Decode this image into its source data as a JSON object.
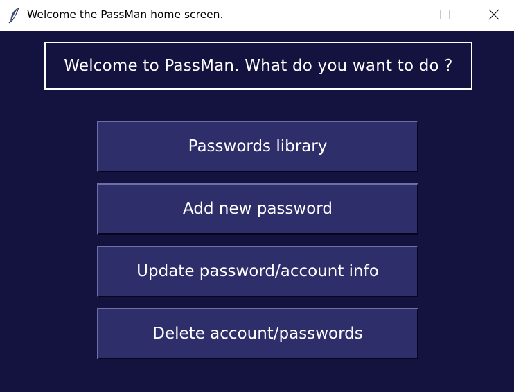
{
  "window": {
    "title": "Welcome the PassMan home screen.",
    "app_icon": "feather-icon",
    "controls": {
      "minimize_icon": "minimize-icon",
      "maximize_icon": "maximize-icon",
      "close_icon": "close-icon"
    }
  },
  "main": {
    "headline": "Welcome to PassMan. What do you want to do ?",
    "buttons": [
      {
        "label": "Passwords library"
      },
      {
        "label": "Add new password"
      },
      {
        "label": "Update password/account info"
      },
      {
        "label": "Delete account/passwords"
      }
    ]
  },
  "colors": {
    "background": "#14123f",
    "button": "#2e2e6b",
    "text": "#ffffff"
  }
}
